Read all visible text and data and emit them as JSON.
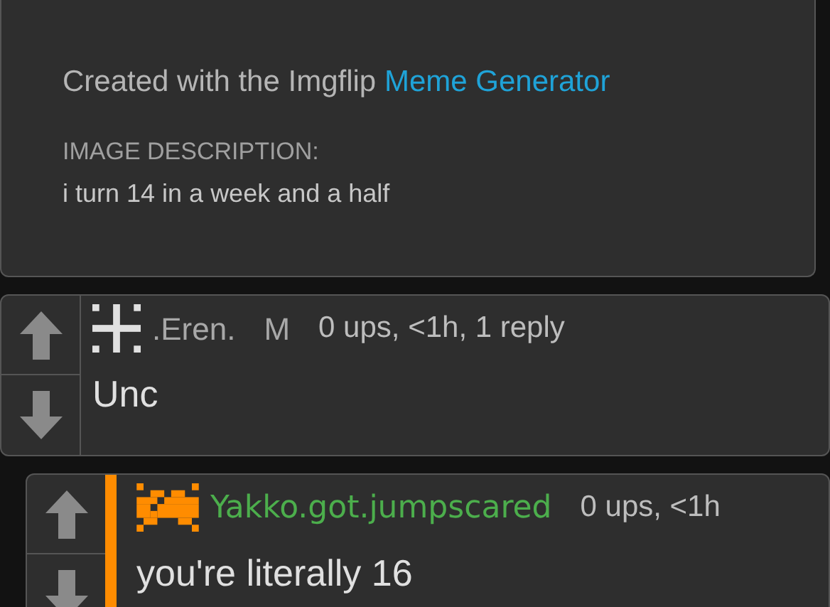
{
  "meme_info": {
    "credit": "Created with the Imgflip",
    "credit_link": "Meme Generator",
    "description_label": "IMAGE DESCRIPTION:",
    "description": "i turn 14 in a week and a half"
  },
  "comments": [
    {
      "username": ".Eren.",
      "color": "#a8a8a8",
      "badge": "M",
      "meta": "0 ups, <1h, 1 reply",
      "body": "Unc",
      "children": [
        {
          "username": "Yakko.got.jumpscared",
          "color": "#4cae4c",
          "meta": "0 ups, <1h",
          "body": "you're literally 16"
        }
      ]
    }
  ]
}
